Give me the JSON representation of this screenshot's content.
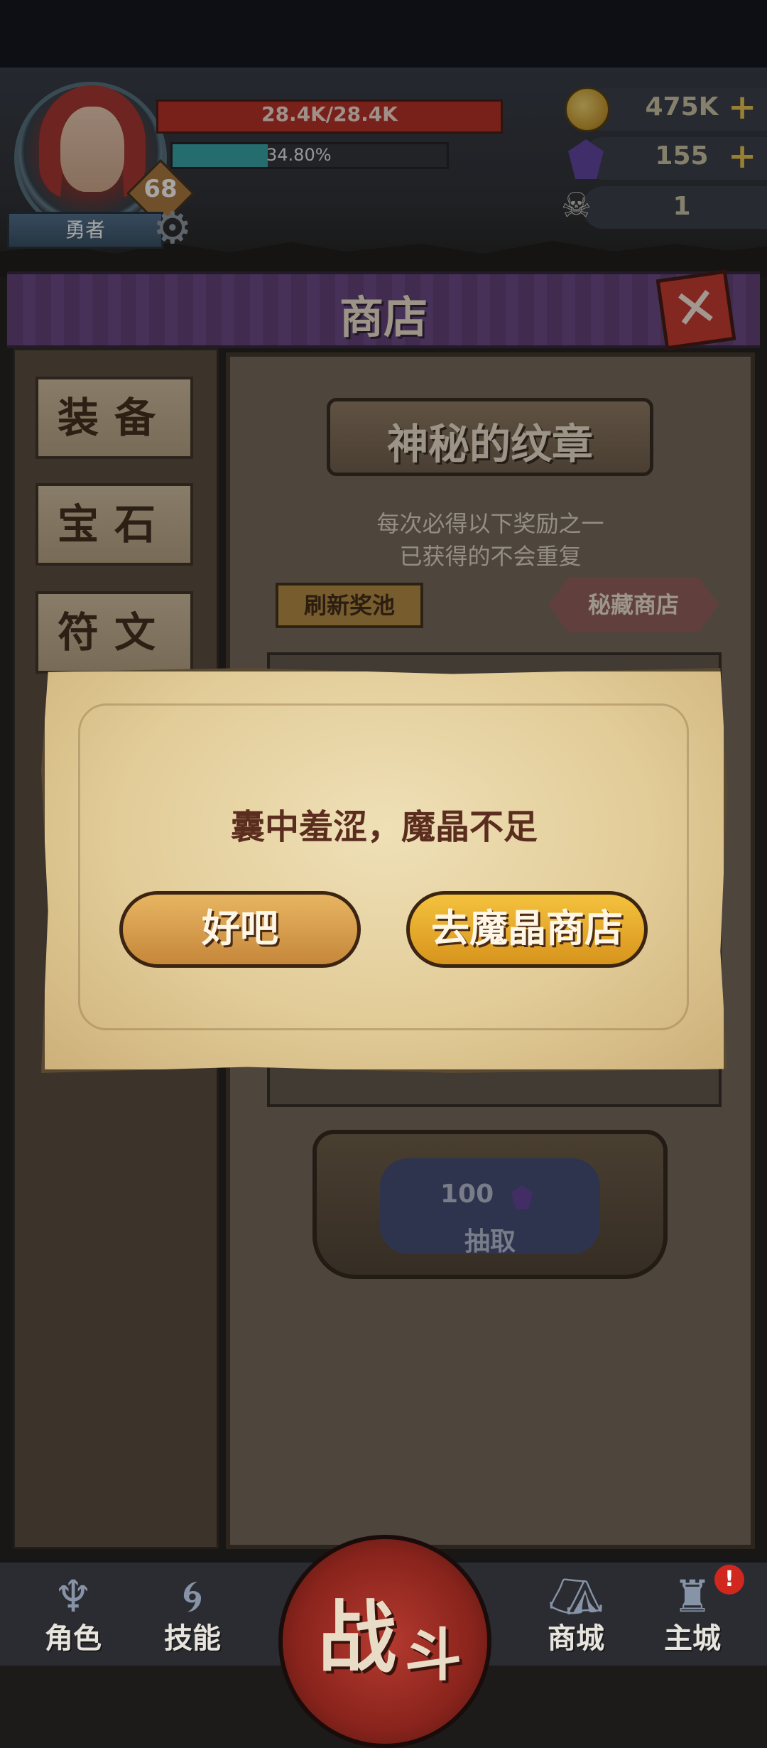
{
  "player": {
    "name": "勇者",
    "level": "68",
    "hp_text": "28.4K/28.4K",
    "xp_text": "34.80%",
    "xp_fraction": 0.348
  },
  "resources": {
    "gold": "475K",
    "crystal": "155",
    "skull": "1",
    "plus_symbol": "+"
  },
  "shop": {
    "title": "商店",
    "close_symbol": "✕",
    "tabs": [
      "装备",
      "宝石",
      "符文"
    ],
    "banner_title": "神秘的纹章",
    "desc_line1": "每次必得以下奖励之一",
    "desc_line2": "已获得的不会重复",
    "refresh_label": "刷新奖池",
    "secret_shop_label": "秘藏商店",
    "draw_cost": "100",
    "draw_label": "抽取"
  },
  "modal": {
    "message": "囊中羞涩，魔晶不足",
    "ok_label": "好吧",
    "goto_label": "去魔晶商店"
  },
  "nav": {
    "items": [
      "角色",
      "技能",
      "商城",
      "主城"
    ],
    "battle_char1": "战",
    "battle_char2": "斗",
    "alert_badge": "!"
  },
  "colors": {
    "hp": "#b52b21",
    "xp": "#2fa3aa",
    "shop_title_bar": "#5c3d78",
    "button_gold": "#d7941c"
  }
}
